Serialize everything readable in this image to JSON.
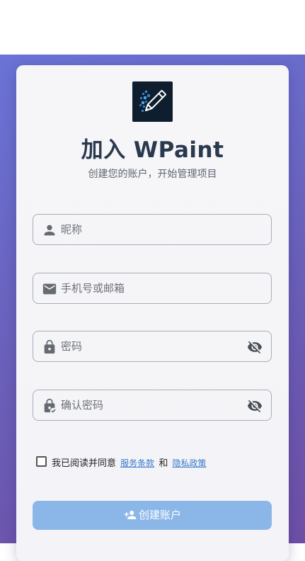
{
  "header": {
    "title": "加入 WPaint",
    "subtitle": "创建您的账户，开始管理项目"
  },
  "form": {
    "nickname_placeholder": "昵称",
    "contact_placeholder": "手机号或邮箱",
    "password_placeholder": "密码",
    "confirm_placeholder": "确认密码"
  },
  "agreement": {
    "prefix": "我已阅读并同意",
    "terms_link": "服务条款",
    "and": "和",
    "privacy_link": "隐私政策",
    "checked": false
  },
  "submit": {
    "label": "创建账户",
    "enabled": false
  },
  "icons": {
    "logo": "pencil-pixel-logo",
    "nickname": "person-icon",
    "contact": "email-icon",
    "password": "lock-icon",
    "confirm": "lock-check-icon",
    "visibility": "eye-off-icon",
    "submit": "person-add-icon"
  },
  "colors": {
    "brand_bg_start": "#6a73d6",
    "brand_bg_end": "#6e4fa6",
    "title": "#2a3a4e",
    "link": "#3a78c9",
    "submit_disabled": "#8ab7e8"
  }
}
